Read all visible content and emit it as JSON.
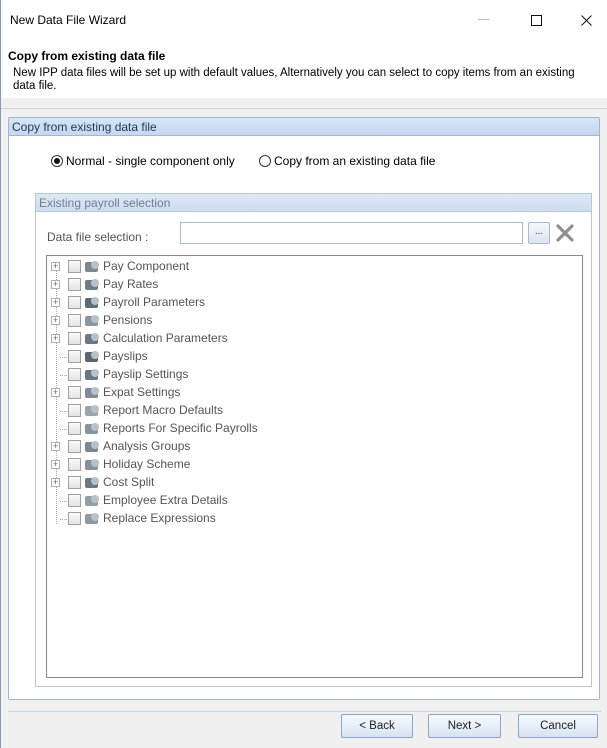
{
  "window": {
    "title": "New Data File Wizard",
    "controls": {
      "minimize": "—",
      "maximize": "☐",
      "close": "✕"
    }
  },
  "header": {
    "title": "Copy from existing data file",
    "description": "New IPP data files will be set up with default values, Alternatively you can select to copy items from an existing data file."
  },
  "group": {
    "title": "Copy from existing data file",
    "options": [
      {
        "label": "Normal - single component only",
        "selected": true
      },
      {
        "label": "Copy from an existing data file",
        "selected": false
      }
    ]
  },
  "payroll": {
    "title": "Existing payroll selection",
    "data_file_label": "Data file selection :",
    "data_file_value": "",
    "browse_label": "...",
    "items": [
      {
        "label": "Pay Component",
        "expandable": true,
        "icon": "pay-component-icon"
      },
      {
        "label": "Pay Rates",
        "expandable": true,
        "icon": "pay-rates-icon"
      },
      {
        "label": "Payroll Parameters",
        "expandable": true,
        "icon": "payroll-parameters-icon"
      },
      {
        "label": "Pensions",
        "expandable": true,
        "icon": "pensions-icon"
      },
      {
        "label": "Calculation Parameters",
        "expandable": true,
        "icon": "calculation-parameters-icon"
      },
      {
        "label": "Payslips",
        "expandable": false,
        "icon": "payslips-icon"
      },
      {
        "label": "Payslip Settings",
        "expandable": false,
        "icon": "payslip-settings-icon"
      },
      {
        "label": "Expat Settings",
        "expandable": true,
        "icon": "expat-settings-icon"
      },
      {
        "label": "Report Macro Defaults",
        "expandable": false,
        "icon": "report-macro-icon"
      },
      {
        "label": "Reports For Specific Payrolls",
        "expandable": false,
        "icon": "reports-icon"
      },
      {
        "label": "Analysis Groups",
        "expandable": true,
        "icon": "analysis-groups-icon"
      },
      {
        "label": "Holiday Scheme",
        "expandable": true,
        "icon": "holiday-scheme-icon"
      },
      {
        "label": "Cost Split",
        "expandable": true,
        "icon": "cost-split-icon"
      },
      {
        "label": "Employee Extra Details",
        "expandable": false,
        "icon": "employee-details-icon"
      },
      {
        "label": "Replace Expressions",
        "expandable": false,
        "icon": "replace-expressions-icon"
      }
    ]
  },
  "footer": {
    "back_label": "< Back",
    "next_label": "Next >",
    "cancel_label": "Cancel"
  }
}
